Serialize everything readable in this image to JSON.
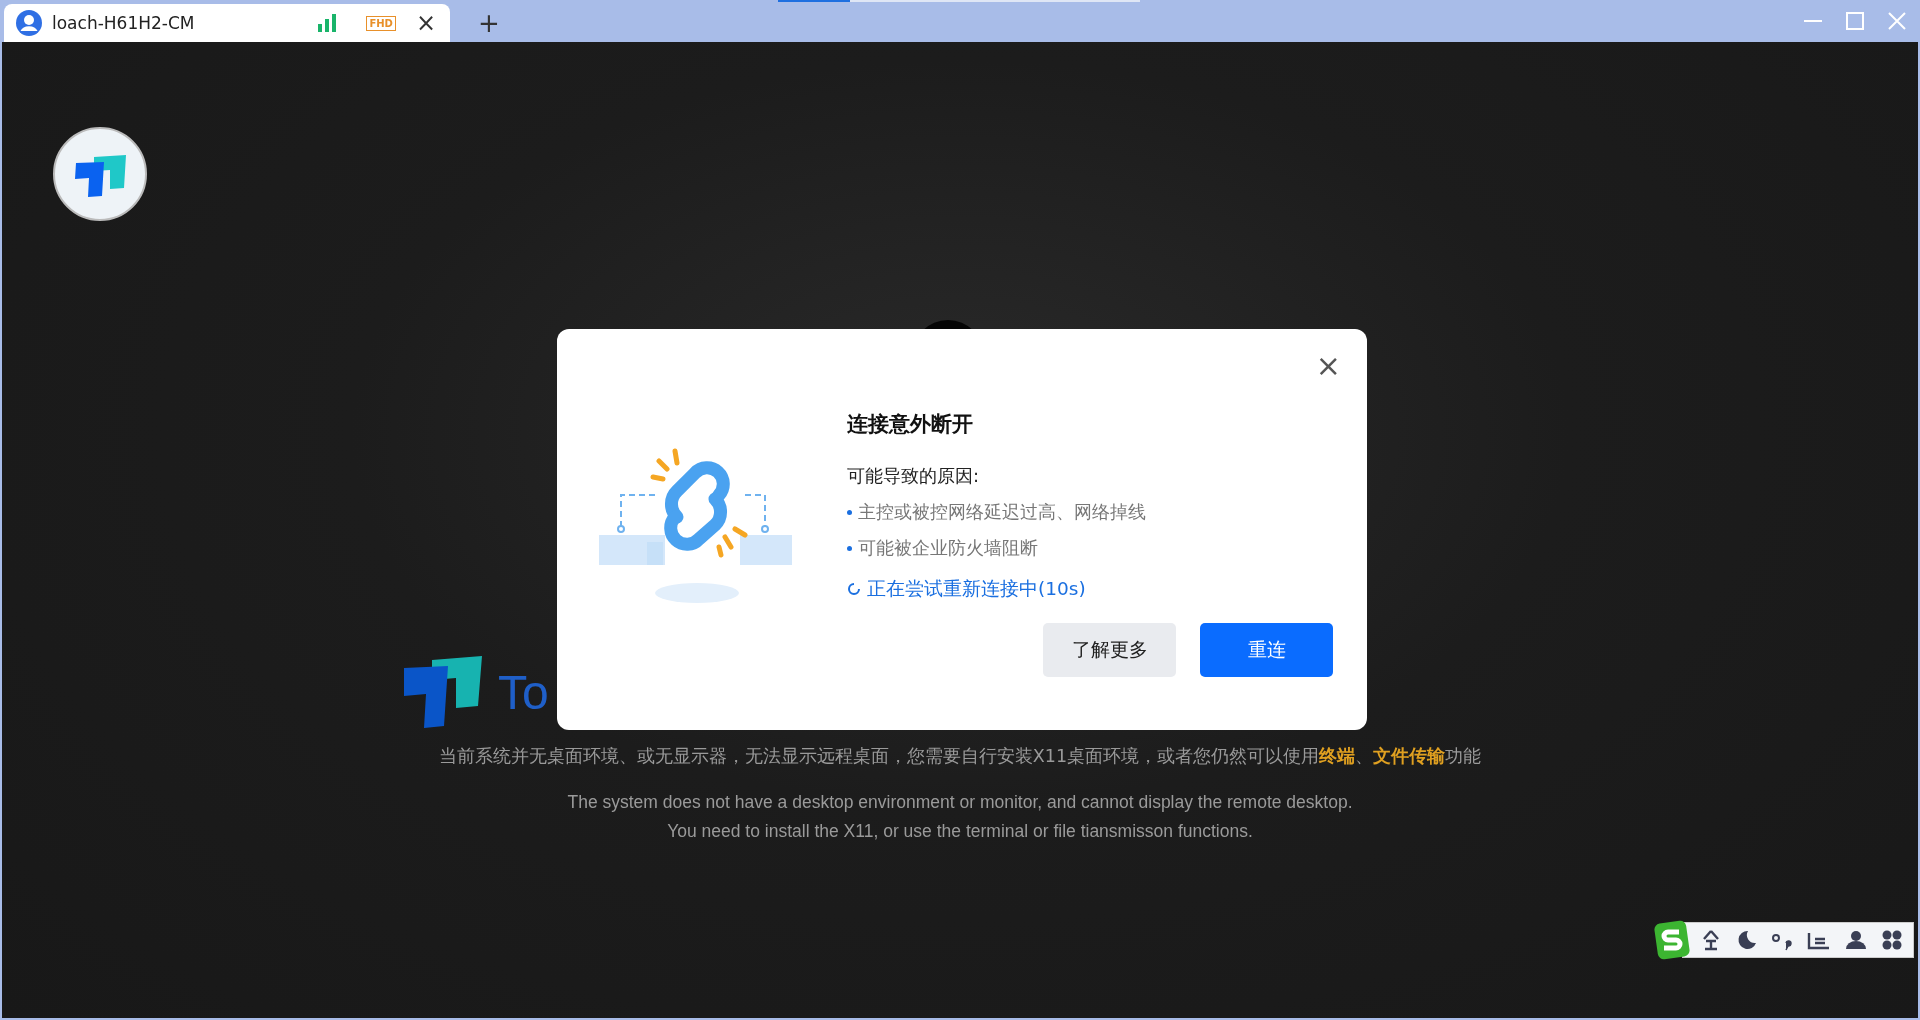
{
  "tabs": [
    {
      "title": "loach-H61H2-CM",
      "selected": true,
      "quality": "FHD",
      "close": "×"
    }
  ],
  "new_tab": "+",
  "background": {
    "logo_text": "To",
    "message": "当前系统并无桌面环境、或无显示器，无法显示远程桌面，您需要自行安装X11桌面环境，或者您仍然可以使用**终端**、**文件传输**功能",
    "english": [
      "The system does not have a desktop environment or monitor, and cannot display the remote desktop.",
      "You need to install the X11, or use the terminal or file tiansmisson functions."
    ]
  },
  "dialog": {
    "close": "×",
    "title": "连接意外断开",
    "reasons_label": "可能导致的原因:",
    "reasons": [
      "主控或被控网络延迟过高、网络掉线",
      "可能被企业防火墙阻断"
    ],
    "status": "正在尝试重新连接中(10s)",
    "buttons": [
      {
        "label": "了解更多",
        "kind": "secondary"
      },
      {
        "label": "重连",
        "kind": "primary"
      }
    ]
  }
}
